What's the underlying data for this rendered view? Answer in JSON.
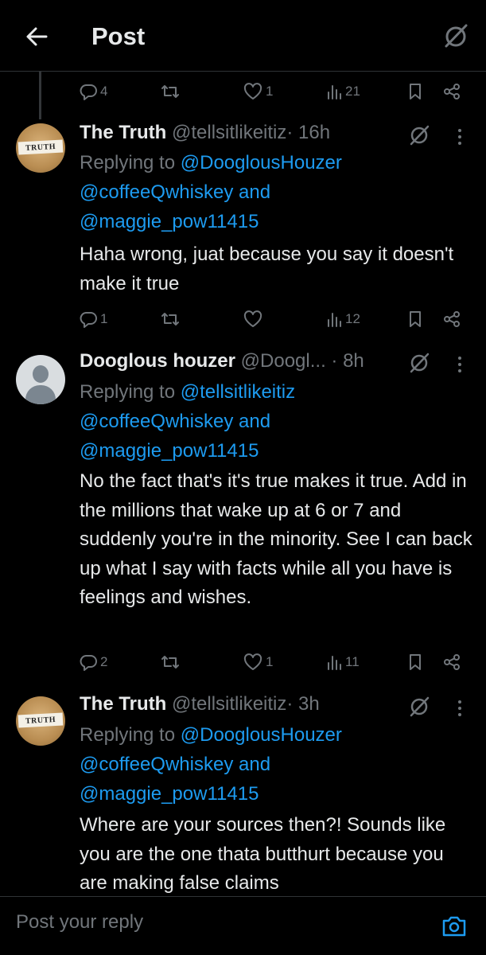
{
  "header": {
    "title": "Post"
  },
  "top_actions": {
    "replies": "4",
    "likes": "1",
    "views": "21"
  },
  "tweets": [
    {
      "name": "The Truth",
      "handle": "@tellsitlikeitiz",
      "time": "· 16h",
      "avatar_text": "TRUTH",
      "replying_prefix": "Replying to ",
      "mention1": "@DooglousHouzer",
      "mention2": "@coffeeQwhiskey",
      "and_text": " and",
      "mention3": "@maggie_pow11415",
      "text": "Haha wrong, juat because you say it doesn't make it true",
      "replies": "1",
      "likes": "",
      "views": "12"
    },
    {
      "name": "Dooglous houzer",
      "handle": "@Doogl...",
      "time": "· 8h",
      "replying_prefix": "Replying to ",
      "mention1": "@tellsitlikeitiz",
      "mention2": "@coffeeQwhiskey",
      "and_text": " and",
      "mention3": "@maggie_pow11415",
      "text": "No the fact that's it's true makes it true. Add in the millions that wake up at 6 or 7 and suddenly you're in the minority. See I can back up what I say with facts while all you have is feelings and wishes.",
      "replies": "2",
      "likes": "1",
      "views": "11"
    },
    {
      "name": "The Truth",
      "handle": "@tellsitlikeitiz",
      "time": "· 3h",
      "avatar_text": "TRUTH",
      "replying_prefix": "Replying to ",
      "mention1": "@DooglousHouzer",
      "mention2": "@coffeeQwhiskey",
      "and_text": " and",
      "mention3": "@maggie_pow11415",
      "text": "Where are your sources then?!  Sounds like you are the one thata butthurt because you are making false claims"
    }
  ],
  "reply_bar": {
    "placeholder": "Post your reply"
  },
  "colors": {
    "background": "#000000",
    "text": "#e7e9ea",
    "muted": "#71767b",
    "accent": "#1d9bf0",
    "divider": "#2f3336"
  },
  "icons": [
    "back-arrow-icon",
    "grok-icon",
    "reply-icon",
    "repost-icon",
    "like-icon",
    "views-icon",
    "bookmark-icon",
    "share-icon",
    "more-icon",
    "camera-icon"
  ]
}
